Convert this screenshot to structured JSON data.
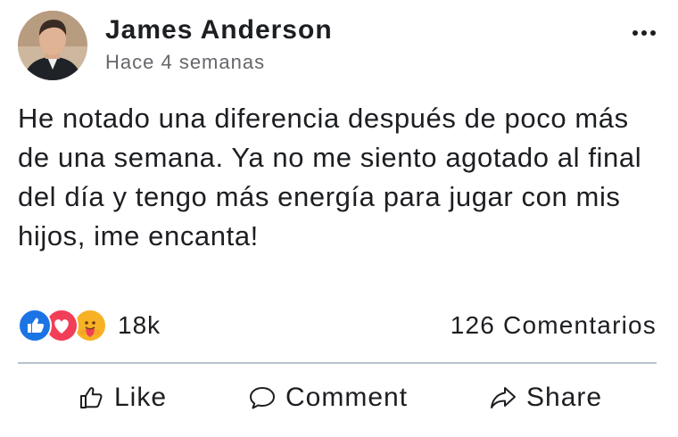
{
  "post": {
    "author_name": "James Anderson",
    "time": "Hace 4 semanas",
    "text": "He notado una diferencia después de poco más de una semana. Ya no me siento agotado al final del día y tengo más energía para jugar con mis hijos, ime encanta!",
    "menu_icon": "more-horizontal-icon"
  },
  "reactions": {
    "icons": [
      "like-reaction-icon",
      "love-reaction-icon",
      "care-reaction-icon"
    ],
    "count": "18k",
    "comments": "126 Comentarios"
  },
  "actions": {
    "like": {
      "label": "Like",
      "icon": "thumbs-up-icon"
    },
    "comment": {
      "label": "Comment",
      "icon": "speech-bubble-icon"
    },
    "share": {
      "label": "Share",
      "icon": "share-arrow-icon"
    }
  },
  "colors": {
    "like_blue": "#1b74e4",
    "love_red": "#f33e58",
    "care_yellow": "#f7b125",
    "text": "#1c1e21",
    "muted": "#65676b",
    "divider": "#b8c2cc"
  }
}
